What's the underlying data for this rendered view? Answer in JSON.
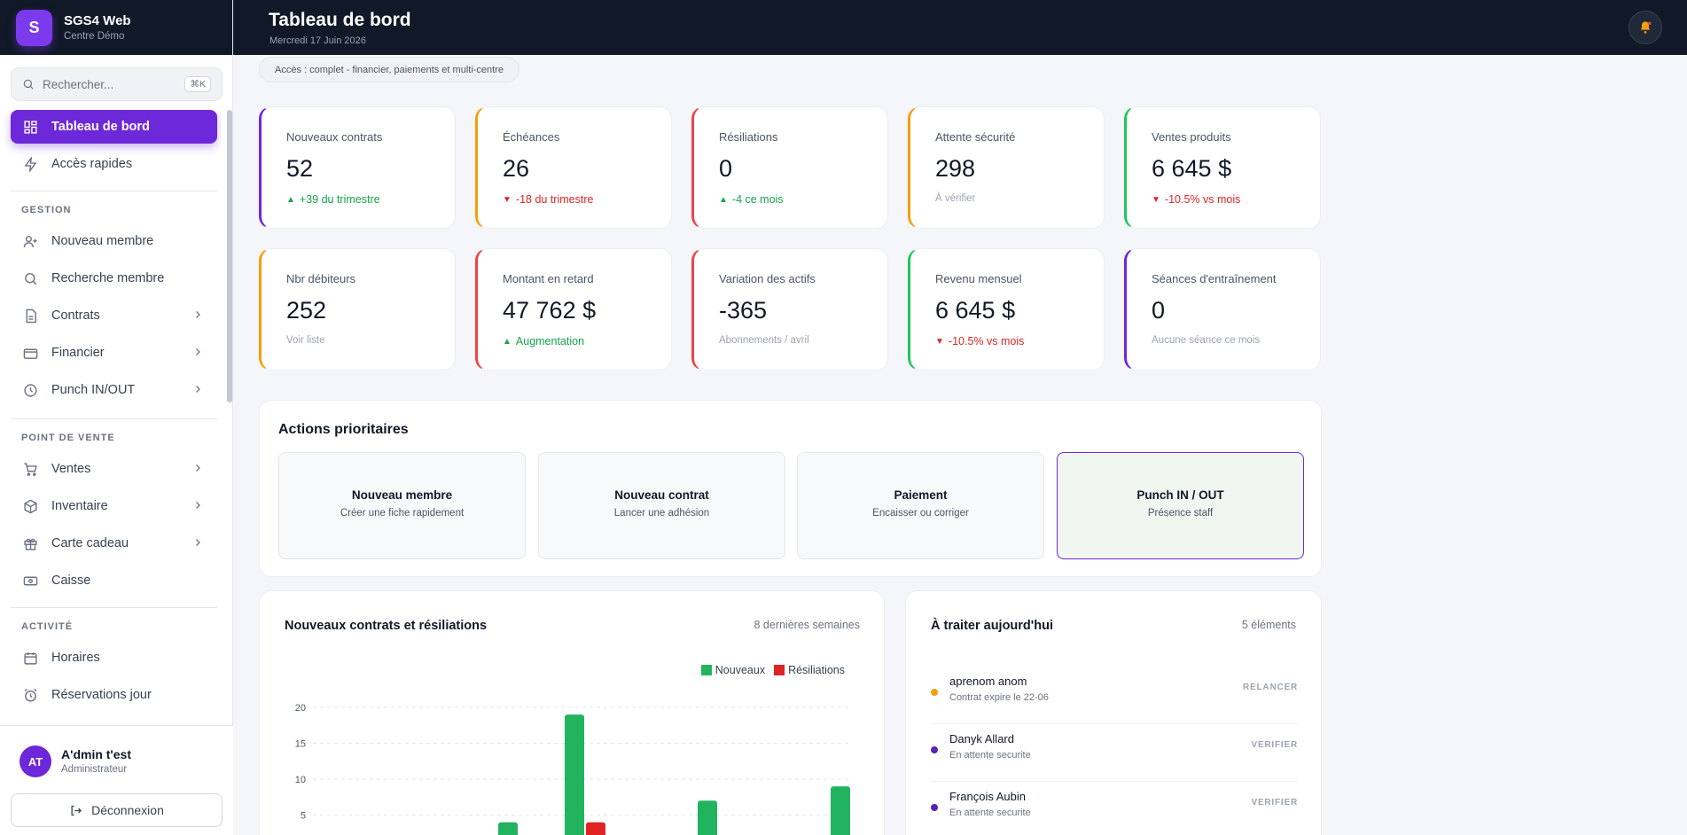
{
  "brand": {
    "initial": "S",
    "name": "SGS4 Web",
    "sub": "Centre Démo"
  },
  "search": {
    "placeholder": "Rechercher...",
    "shortcut": "⌘K"
  },
  "nav": {
    "dashboard": "Tableau de bord",
    "quick": "Accès rapides",
    "sec_gestion": "GESTION",
    "new_member": "Nouveau membre",
    "search_member": "Recherche membre",
    "contracts": "Contrats",
    "financial": "Financier",
    "punch": "Punch IN/OUT",
    "sec_pos": "POINT DE VENTE",
    "sales": "Ventes",
    "inventory": "Inventaire",
    "gift": "Carte cadeau",
    "cash": "Caisse",
    "sec_activity": "ACTIVITÉ",
    "schedules": "Horaires",
    "reservations": "Réservations jour"
  },
  "user": {
    "initials": "AT",
    "name": "A'dmin t'est",
    "role": "Administrateur",
    "logout": "Déconnexion"
  },
  "header": {
    "title": "Tableau de bord",
    "date": "Mercredi 17 Juin 2026"
  },
  "access": "Accès : complet - financier, paiements et multi-centre",
  "kpis": [
    {
      "label": "Nouveaux contrats",
      "value": "52",
      "sub": "+39 du trimestre",
      "trend": "up",
      "accent": "#6d28d9"
    },
    {
      "label": "Échéances",
      "value": "26",
      "sub": "-18 du trimestre",
      "trend": "down",
      "accent": "#f59e0b"
    },
    {
      "label": "Résiliations",
      "value": "0",
      "sub": "-4 ce mois",
      "trend": "up",
      "accent": "#ef4444"
    },
    {
      "label": "Attente sécurité",
      "value": "298",
      "sub": "À vérifier",
      "trend": "none",
      "accent": "#f59e0b"
    },
    {
      "label": "Ventes produits",
      "value": "6 645 $",
      "sub": "-10.5% vs mois",
      "trend": "down",
      "accent": "#22c55e"
    },
    {
      "label": "Nbr débiteurs",
      "value": "252",
      "sub": "Voir liste",
      "trend": "none",
      "accent": "#f59e0b"
    },
    {
      "label": "Montant en retard",
      "value": "47 762 $",
      "sub": "Augmentation",
      "trend": "up",
      "accent": "#ef4444"
    },
    {
      "label": "Variation des actifs",
      "value": "-365",
      "sub": "Abonnements / avril",
      "trend": "none",
      "accent": "#ef4444"
    },
    {
      "label": "Revenu mensuel",
      "value": "6 645 $",
      "sub": "-10.5% vs mois",
      "trend": "down",
      "accent": "#22c55e"
    },
    {
      "label": "Séances d'entraînement",
      "value": "0",
      "sub": "Aucune séance ce mois",
      "trend": "none",
      "accent": "#6d28d9"
    }
  ],
  "actions": {
    "title": "Actions prioritaires",
    "items": [
      {
        "title": "Nouveau membre",
        "sub": "Créer une fiche rapidement"
      },
      {
        "title": "Nouveau contrat",
        "sub": "Lancer une adhésion"
      },
      {
        "title": "Paiement",
        "sub": "Encaisser ou corriger"
      },
      {
        "title": "Punch IN / OUT",
        "sub": "Présence staff"
      }
    ]
  },
  "chart": {
    "title": "Nouveaux contrats et résiliations",
    "range": "8 dernières semaines",
    "legend_new": "Nouveaux",
    "legend_cancel": "Résiliations"
  },
  "todo": {
    "title": "À traiter aujourd'hui",
    "count": "5 éléments",
    "items": [
      {
        "name": "aprenom anom",
        "desc": "Contrat expire le 22-06",
        "action": "RELANCER",
        "color": "#f59e0b"
      },
      {
        "name": "Danyk Allard",
        "desc": "En attente securite",
        "action": "VERIFIER",
        "color": "#5b21b6"
      },
      {
        "name": "François Aubin",
        "desc": "En attente securite",
        "action": "VERIFIER",
        "color": "#5b21b6"
      }
    ]
  },
  "chart_data": {
    "type": "bar",
    "categories": [
      "",
      "",
      "",
      "",
      "",
      "",
      "",
      ""
    ],
    "series": [
      {
        "name": "Nouveaux",
        "color": "#22b35e",
        "values": [
          0,
          0,
          4,
          19,
          0,
          7,
          0,
          9
        ]
      },
      {
        "name": "Résiliations",
        "color": "#e02424",
        "values": [
          0,
          0,
          0,
          4,
          0,
          0,
          0,
          0
        ]
      }
    ],
    "yticks": [
      5,
      10,
      15,
      20
    ],
    "ylim": [
      0,
      20
    ],
    "grid": true,
    "legend": "top-right"
  }
}
